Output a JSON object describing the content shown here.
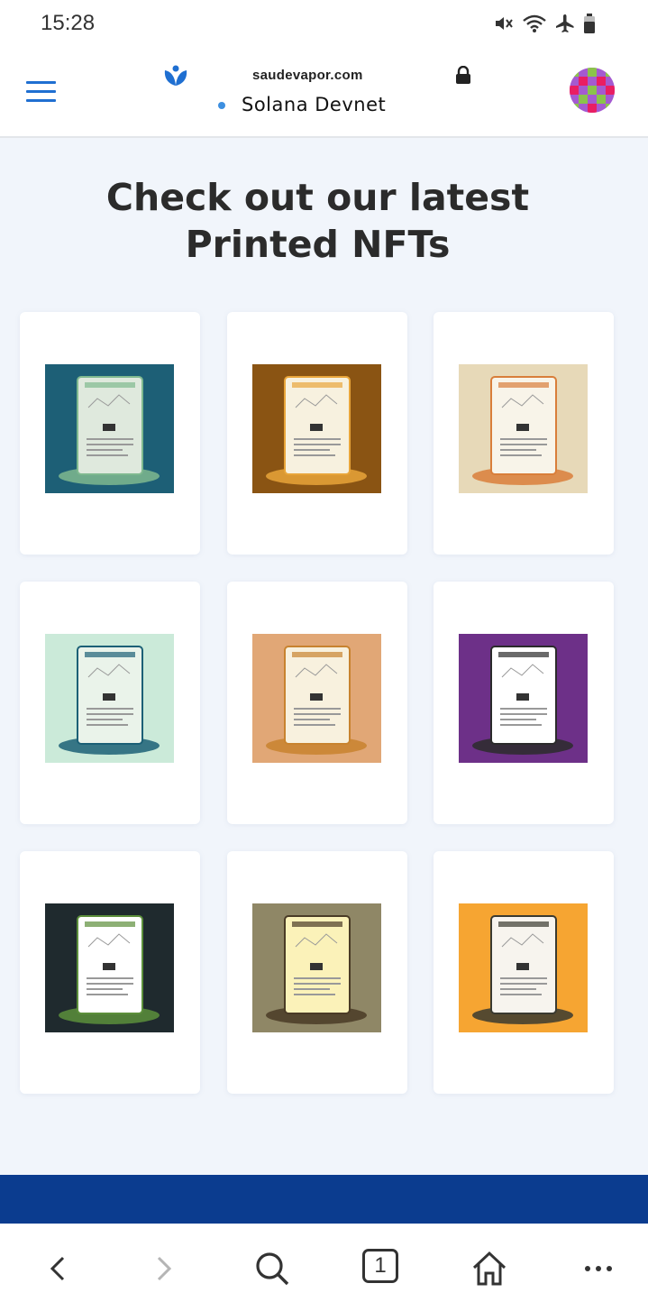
{
  "status": {
    "time": "15:28",
    "icons": [
      "mute-vibrate-icon",
      "wifi-icon",
      "airplane-icon",
      "battery-icon"
    ]
  },
  "header": {
    "site_domain": "saudevapor.com",
    "network_label": "Solana Devnet",
    "menu_icon": "hamburger-menu-icon",
    "lock_icon": "lock-icon",
    "avatar": "avatar"
  },
  "main": {
    "title": "Check out our latest Printed NFTs",
    "nfts": [
      {
        "label": "nft-1",
        "bg": "#1d5f76",
        "card": "#dfe9dd",
        "accent": "#7fb98f"
      },
      {
        "label": "nft-2",
        "bg": "#8a5413",
        "card": "#f7f1df",
        "accent": "#e8a53a"
      },
      {
        "label": "nft-3",
        "bg": "#e7d9b8",
        "card": "#f8f4e9",
        "accent": "#d97e3a"
      },
      {
        "label": "nft-4",
        "bg": "#cbead9",
        "card": "#eaf3ea",
        "accent": "#1c6076"
      },
      {
        "label": "nft-5",
        "bg": "#e1a776",
        "card": "#f8f1de",
        "accent": "#c8832f"
      },
      {
        "label": "nft-6",
        "bg": "#6d3088",
        "card": "#ffffff",
        "accent": "#2b2b2b"
      },
      {
        "label": "nft-7",
        "bg": "#1f2a2e",
        "card": "#ffffff",
        "accent": "#5c8f3b"
      },
      {
        "label": "nft-8",
        "bg": "#8f8766",
        "card": "#fbf2b9",
        "accent": "#4a3b26"
      },
      {
        "label": "nft-9",
        "bg": "#f6a532",
        "card": "#f7f4ee",
        "accent": "#3a3a30"
      }
    ]
  },
  "nav": {
    "back": "back-icon",
    "forward": "forward-icon",
    "search": "search-icon",
    "tab_count": "1",
    "home": "home-icon",
    "more": "more-icon"
  },
  "colors": {
    "accent_blue": "#1f6fd1",
    "footer_band": "#0b3c8f",
    "page_bg": "#f1f5fb"
  }
}
